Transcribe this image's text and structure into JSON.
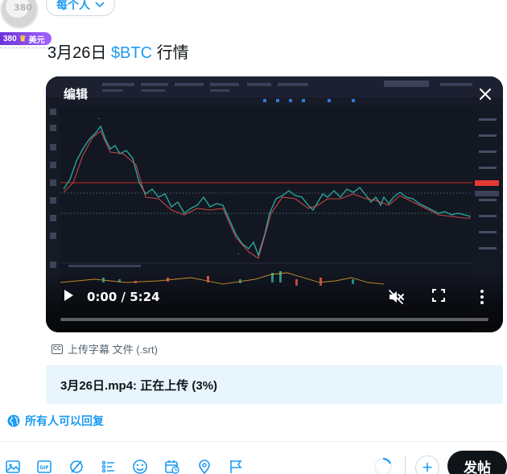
{
  "header": {
    "avatar_number": "380",
    "badge_label": "380",
    "badge_text": "美元",
    "audience_label": "每个人"
  },
  "post": {
    "text_prefix": "3月26日 ",
    "cashtag": "$BTC",
    "text_suffix": " 行情"
  },
  "video": {
    "edit_label": "编辑",
    "time": "0:00 / 5:24",
    "progress_fraction": 0.0
  },
  "caption": {
    "cc_icon_text": "CC",
    "label": "上传字幕 文件 (.srt)"
  },
  "upload": {
    "status": "3月26日.mp4: 正在上传 (3%)",
    "percent": 3
  },
  "reply": {
    "label": "所有人可以回复"
  },
  "toolbar": {
    "icons": [
      "media-icon",
      "gif-icon",
      "grok-icon",
      "poll-icon",
      "emoji-icon",
      "schedule-icon",
      "location-icon",
      "flag-icon"
    ],
    "add_symbol": "+",
    "post_label": "发帖"
  },
  "colors": {
    "accent": "#1d9bf0",
    "text": "#0f1419",
    "muted": "#536471",
    "upload_bg": "#e8f5fd",
    "chart_bg": "#131722",
    "candle_up": "#26a69a",
    "candle_down": "#ef5350"
  }
}
